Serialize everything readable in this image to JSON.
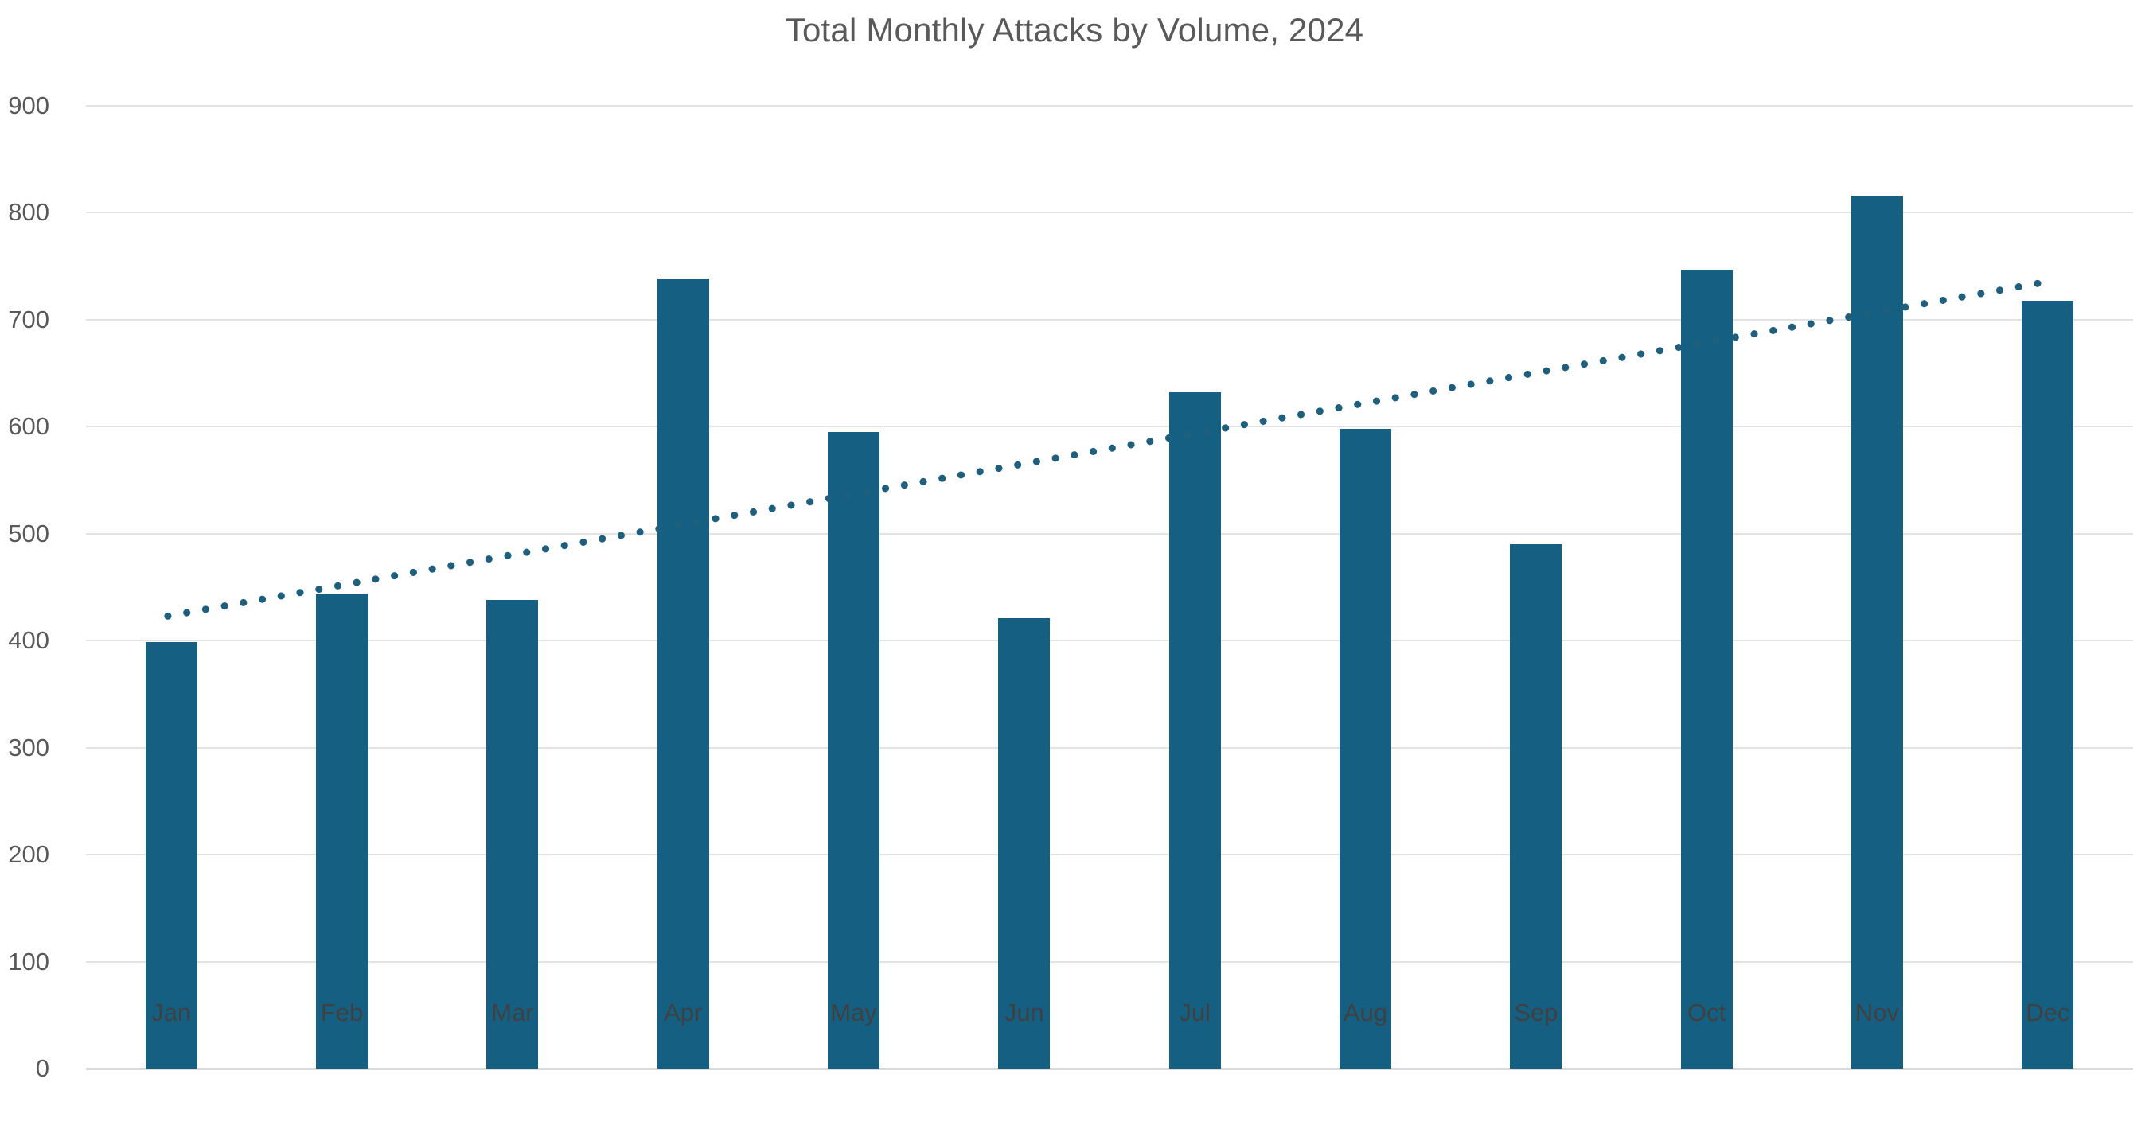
{
  "chart_data": {
    "type": "bar",
    "title": "Total Monthly Attacks by Volume, 2024",
    "xlabel": "",
    "ylabel": "",
    "categories": [
      "Jan",
      "Feb",
      "Mar",
      "Apr",
      "May",
      "Jun",
      "Jul",
      "Aug",
      "Sep",
      "Oct",
      "Nov",
      "Dec"
    ],
    "values": [
      399,
      444,
      438,
      738,
      595,
      421,
      632,
      598,
      490,
      747,
      816,
      718
    ],
    "series": [
      {
        "name": "Total Monthly Attacks",
        "values": [
          399,
          444,
          438,
          738,
          595,
          421,
          632,
          598,
          490,
          747,
          816,
          718
        ]
      }
    ],
    "ylim": [
      0,
      900
    ],
    "y_ticks": [
      0,
      100,
      200,
      300,
      400,
      500,
      600,
      700,
      800,
      900
    ],
    "y_tick_labels": [
      "0",
      "100",
      "200",
      "300",
      "400",
      "500",
      "600",
      "700",
      "800",
      "900"
    ],
    "grid": true,
    "grid_axis": "y",
    "legend": false,
    "legend_position": "none",
    "bar_color": "#156082",
    "gridline_color": "#e3e3e3",
    "title_color": "#595959",
    "tick_label_color": "#595959",
    "background_color": "#ffffff",
    "annotations": [
      {
        "type": "trendline",
        "name": "linear-trendline",
        "style": "dotted",
        "color": "#1F5F7E",
        "x_start_category_fraction": 0.48,
        "x_end_category_fraction": 11.55,
        "y_start": 423,
        "y_end": 737
      }
    ]
  }
}
